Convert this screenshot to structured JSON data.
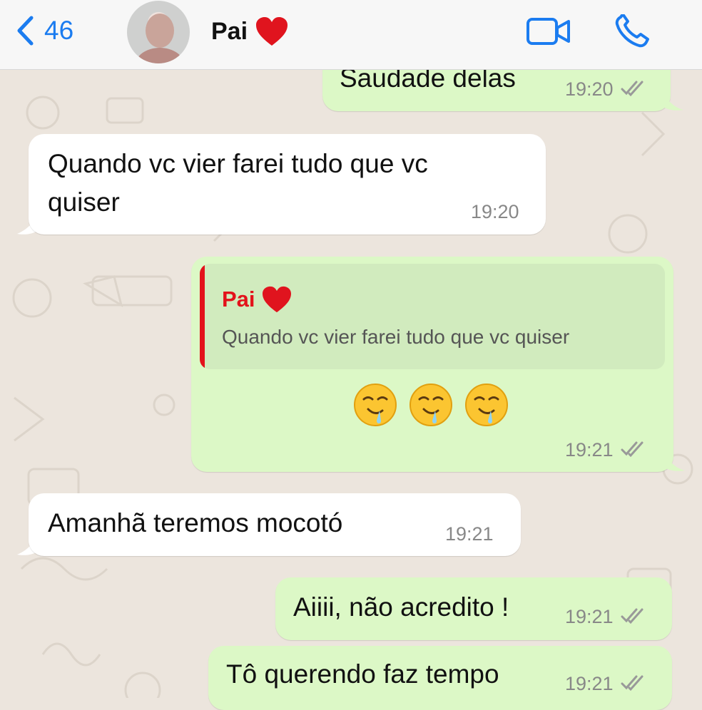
{
  "header": {
    "back_count": "46",
    "contact_name": "Pai",
    "contact_emoji": "red-heart-icon"
  },
  "colors": {
    "accent": "#1b7cf0",
    "incoming_bubble": "#ffffff",
    "outgoing_bubble": "#dcf8c6",
    "quote_accent": "#e3121b",
    "chat_background": "#ece5dd"
  },
  "messages": [
    {
      "direction": "outgoing",
      "text": "Saudade delas",
      "time": "19:20",
      "status": "read-ticks"
    },
    {
      "direction": "incoming",
      "text_line1": "Quando vc vier farei tudo que vc",
      "text_line2": "quiser",
      "time": "19:20"
    },
    {
      "direction": "outgoing",
      "quote": {
        "author": "Pai",
        "text": "Quando vc vier farei tudo que vc quiser"
      },
      "emojis": [
        "drooling-face-icon",
        "drooling-face-icon",
        "drooling-face-icon"
      ],
      "time": "19:21",
      "status": "read-ticks"
    },
    {
      "direction": "incoming",
      "text": "Amanhã teremos mocotó",
      "time": "19:21"
    },
    {
      "direction": "outgoing",
      "text": "Aiiii, não acredito !",
      "time": "19:21",
      "status": "read-ticks"
    },
    {
      "direction": "outgoing",
      "text": "Tô querendo faz tempo",
      "time": "19:21",
      "status": "read-ticks"
    }
  ]
}
